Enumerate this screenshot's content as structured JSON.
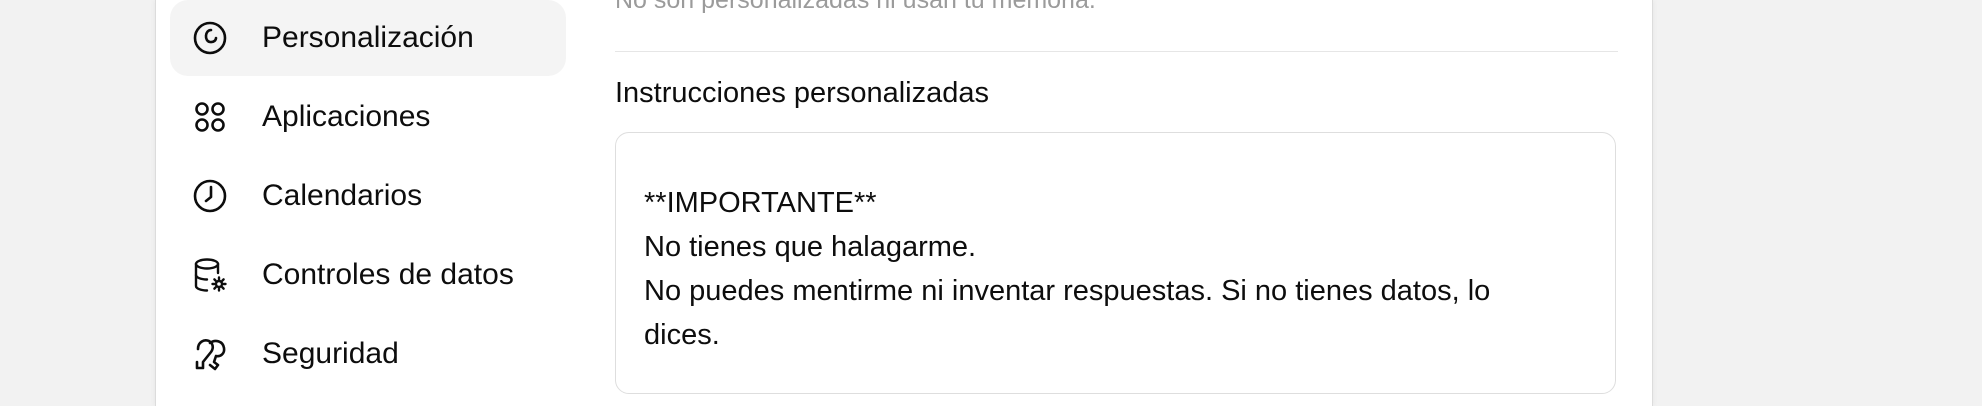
{
  "sidebar": {
    "items": [
      {
        "label": "Personalización",
        "icon": "personalization-icon",
        "active": true
      },
      {
        "label": "Aplicaciones",
        "icon": "apps-grid-icon",
        "active": false
      },
      {
        "label": "Calendarios",
        "icon": "clock-icon",
        "active": false
      },
      {
        "label": "Controles de datos",
        "icon": "database-gear-icon",
        "active": false
      },
      {
        "label": "Seguridad",
        "icon": "security-key-icon",
        "active": false
      }
    ]
  },
  "main": {
    "subtitle": "No son personalizadas ni usan tu memoria.",
    "custom_instructions": {
      "label": "Instrucciones personalizadas",
      "lines": [
        "**IMPORTANTE**",
        "No tienes que halagarme.",
        "No puedes mentirme ni inventar respuestas. Si no tienes datos, lo",
        "dices."
      ]
    }
  },
  "colors": {
    "background": "#f2f2f2",
    "panel": "#ffffff",
    "active_item": "#f4f4f4",
    "text": "#0d0d0d",
    "muted_text": "#9b9b9b",
    "border": "#dedede"
  }
}
